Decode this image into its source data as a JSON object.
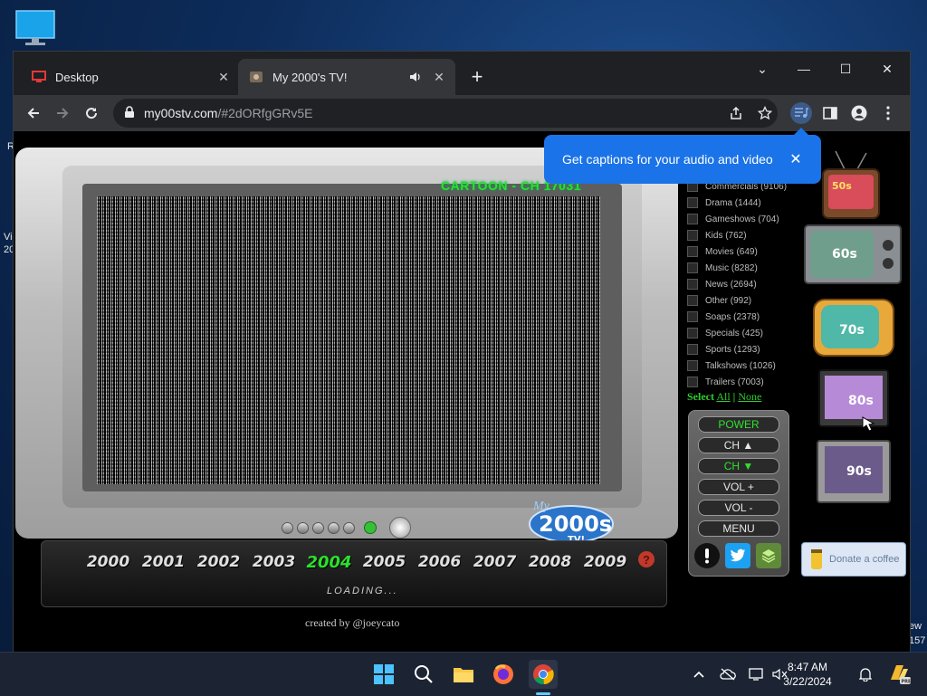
{
  "desktop": {
    "icon_name": "monitor-icon",
    "side_left_1": "R",
    "side_left_2": "Vi",
    "side_left_3": "20",
    "side_right_1": "ew",
    "side_right_2": "157"
  },
  "browser": {
    "tabs": [
      {
        "label": "Desktop",
        "icon": "monitor-favicon"
      },
      {
        "label": "My 2000's TV!",
        "icon": "tv-favicon"
      }
    ],
    "url_host": "my00stv.com",
    "url_path": "/#2dORfgGRv5E"
  },
  "captions_popup": {
    "text": "Get captions for your audio and video"
  },
  "tv": {
    "channel": "CARTOON - CH 17031",
    "years": [
      "2000",
      "2001",
      "2002",
      "2003",
      "2004",
      "2005",
      "2006",
      "2007",
      "2008",
      "2009"
    ],
    "active_year": "2004",
    "loading": "LOADING...",
    "credit": "created by @joeycato",
    "help": "?"
  },
  "genres": [
    "Commercials (9106)",
    "Drama (1444)",
    "Gameshows (704)",
    "Kids (762)",
    "Movies (649)",
    "Music (8282)",
    "News (2694)",
    "Other (992)",
    "Soaps (2378)",
    "Specials (425)",
    "Sports (1293)",
    "Talkshows (1026)",
    "Trailers (7003)"
  ],
  "select": {
    "prefix": "Select",
    "all": "All",
    "sep": "|",
    "none": "None"
  },
  "remote": {
    "power": "POWER",
    "ch_up": "CH ▲",
    "ch_down": "CH ▼",
    "vol_up": "VOL +",
    "vol_down": "VOL -",
    "menu": "MENU"
  },
  "decades": [
    "50s",
    "60s",
    "70s",
    "80s",
    "90s"
  ],
  "donate": "Donate a coffee",
  "taskbar": {
    "time": "8:47 AM",
    "date": "3/22/2024"
  }
}
